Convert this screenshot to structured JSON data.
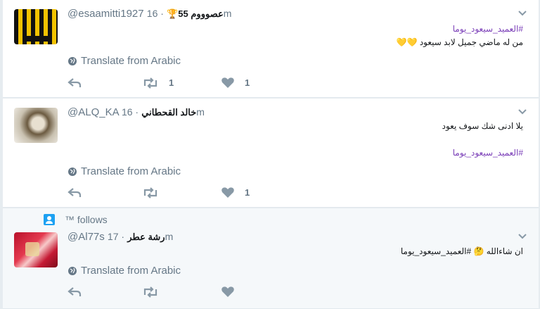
{
  "colors": {
    "accent": "#7b3fb8",
    "muted": "#657786",
    "link": "#1da1f2"
  },
  "tweets": [
    {
      "handle": "@esaamitti1927",
      "name": "عصوووم 55🏆",
      "time": "16m",
      "hashtag": "#العميد_سيعود_يوما",
      "text": "من له ماضي جميل لابد سيعود 💛💛",
      "translate": "Translate from Arabic",
      "retweets": "1",
      "likes": "1"
    },
    {
      "handle": "@ALQ_KA",
      "name": "خالد القحطاني",
      "time": "16m",
      "text": "يلا ادنى شك سوف يعود",
      "hashtag": "#العميد_سيعود_يوما",
      "translate": "Translate from Arabic",
      "retweets": "",
      "likes": "1"
    },
    {
      "context": "™ follows",
      "handle": "@Al77s",
      "name": "رشة عطر",
      "time": "17m",
      "text": "ان شاءالله 🤔 #العميد_سيعود_يوما",
      "translate": "Translate from Arabic",
      "retweets": "",
      "likes": ""
    }
  ],
  "icons": [
    "caret-down-icon",
    "globe-icon",
    "reply-icon",
    "retweet-icon",
    "heart-icon",
    "user-follows-icon"
  ]
}
